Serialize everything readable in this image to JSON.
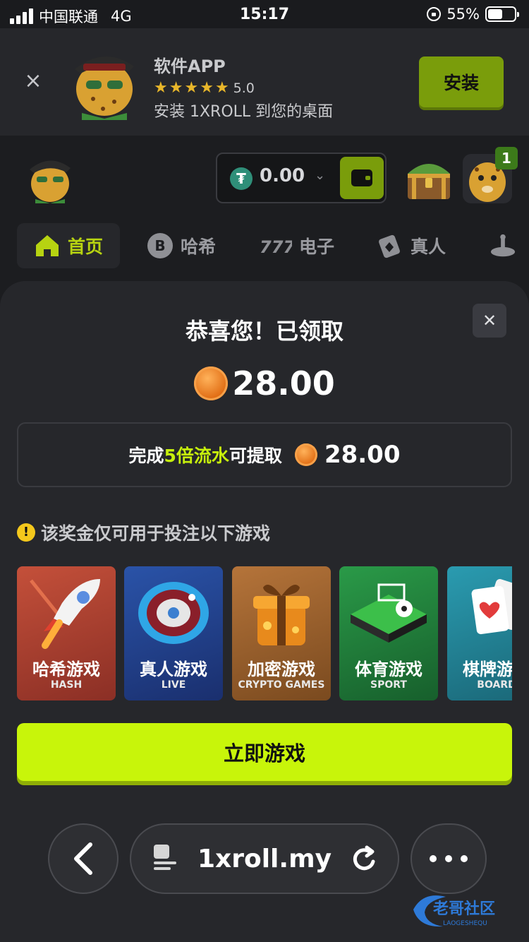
{
  "status_bar": {
    "carrier": "中国联通",
    "network": "4G",
    "time": "15:17",
    "battery": "55%"
  },
  "app_banner": {
    "app_name": "软件APP",
    "rating": "5.0",
    "description": "安装 1XROLL 到您的桌面",
    "install_label": "安装"
  },
  "header": {
    "balance": "0.00",
    "currency_symbol": "₮",
    "notification_count": "1"
  },
  "nav_tabs": [
    {
      "label": "首页",
      "icon": "home-icon",
      "active": true
    },
    {
      "label": "哈希",
      "icon": "bitcoin-icon"
    },
    {
      "label": "电子",
      "icon": "slot-777-icon"
    },
    {
      "label": "真人",
      "icon": "cards-icon"
    },
    {
      "label": "",
      "icon": "roulette-icon"
    }
  ],
  "modal": {
    "title": "恭喜您！已领取",
    "amount": "28.00",
    "wager_prefix": "完成",
    "wager_highlight": "5倍流水",
    "wager_suffix": "可提取",
    "wager_amount": "28.00",
    "notice": "该奖金仅可用于投注以下游戏",
    "games": [
      {
        "cn": "哈希游戏",
        "en": "HASH"
      },
      {
        "cn": "真人游戏",
        "en": "LIVE"
      },
      {
        "cn": "加密游戏",
        "en": "CRYPTO GAMES"
      },
      {
        "cn": "体育游戏",
        "en": "SPORT"
      },
      {
        "cn": "棋牌游戏",
        "en": "BOARD"
      }
    ],
    "play_label": "立即游戏"
  },
  "browser": {
    "url": "1xroll.my"
  },
  "watermark": {
    "text": "老哥社区",
    "sub": "LAOGESHEQU"
  },
  "colors": {
    "accent": "#c8f50a",
    "banner_button": "#7a9d0b",
    "background": "#1c1d20",
    "sheet": "#26272b"
  }
}
